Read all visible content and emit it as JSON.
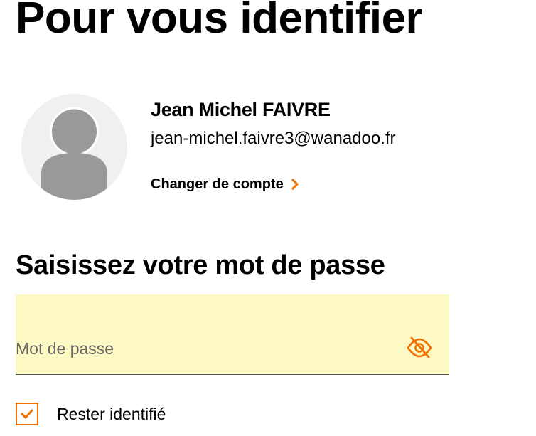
{
  "page": {
    "title": "Pour vous identifier"
  },
  "account": {
    "avatar_icon": "user-silhouette-icon",
    "name": "Jean Michel FAIVRE",
    "email": "jean-michel.faivre3@wanadoo.fr",
    "change_account_label": "Changer de compte",
    "change_account_icon": "chevron-right-icon"
  },
  "password_section": {
    "title": "Saisissez votre mot de passe",
    "field": {
      "placeholder": "Mot de passe",
      "value": "",
      "toggle_icon": "eye-slash-icon"
    }
  },
  "stay_logged": {
    "label": "Rester identifié",
    "checked": true,
    "icon": "checkmark-icon"
  },
  "colors": {
    "accent": "#f16e00",
    "field_background": "#fdf9c4",
    "avatar_background": "#f0f0f0",
    "avatar_figure": "#999999",
    "text": "#000000"
  }
}
